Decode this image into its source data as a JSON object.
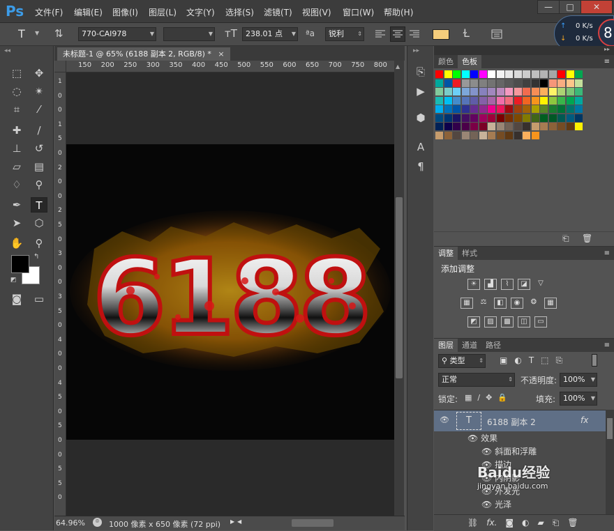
{
  "app": {
    "logo": "Ps"
  },
  "menus": [
    "文件(F)",
    "编辑(E)",
    "图像(I)",
    "图层(L)",
    "文字(Y)",
    "选择(S)",
    "滤镜(T)",
    "视图(V)",
    "窗口(W)",
    "帮助(H)"
  ],
  "window_buttons": {
    "minimize": "—",
    "maximize": "□",
    "close": "✕"
  },
  "network": {
    "up": "0 K/s",
    "down": "0 K/s",
    "badge": "8"
  },
  "options": {
    "tool_glyph": "T",
    "font_family": "770-CAI978",
    "font_style": "",
    "font_size": "238.01 点",
    "aa_label": "ªa",
    "antialias": "锐利",
    "text_color": "#f5cd7c"
  },
  "document": {
    "tab_title": "未标题-1 @ 65% (6188 副本 2, RGB/8) *",
    "close": "×",
    "artwork_text": "6188",
    "h_ruler": [
      "150",
      "200",
      "250",
      "300",
      "350",
      "400",
      "450",
      "500",
      "550",
      "600",
      "650",
      "700",
      "750",
      "800"
    ],
    "v_ruler": [
      "1",
      "0",
      "0",
      "1",
      "5",
      "0",
      "2",
      "0",
      "0",
      "2",
      "5",
      "0",
      "3",
      "0",
      "0",
      "3",
      "5",
      "0",
      "4",
      "0",
      "0",
      "4",
      "5",
      "0",
      "5",
      "0",
      "0",
      "5",
      "5",
      "0"
    ]
  },
  "status": {
    "zoom": "64.96%",
    "info": "1000 像素 x 650 像素 (72 ppi)"
  },
  "colors": {
    "foreground": "#000000",
    "background": "#ffffff"
  },
  "swatch_panel": {
    "tabs": [
      "颜色",
      "色板"
    ],
    "active": "色板",
    "rows": [
      [
        "#ff0000",
        "#ffff00",
        "#00ff00",
        "#00ffff",
        "#0000ff",
        "#ff00ff",
        "#ffffff",
        "#f2f2f2",
        "#e6e6e6",
        "#d9d9d9",
        "#cccccc",
        "#bfbfbf",
        "#b3b3b3",
        "#a6a6a6",
        "#ff0000",
        "#ffff00",
        "#00a650"
      ],
      [
        "#00a99d",
        "#0054a6",
        "#ed1c24",
        "#999999",
        "#8c8c8c",
        "#808080",
        "#737373",
        "#666666",
        "#595959",
        "#4d4d4d",
        "#404040",
        "#333333",
        "#000000",
        "#f69679",
        "#f9ad81",
        "#fdc68a",
        "#c4df9b"
      ],
      [
        "#82ca9c",
        "#7accc8",
        "#6dcff6",
        "#7da7d9",
        "#8393ca",
        "#8781bd",
        "#a187be",
        "#bd8cbf",
        "#f49ac1",
        "#f5989d",
        "#f26c4f",
        "#f68e56",
        "#fbaf5d",
        "#fff467",
        "#acd373",
        "#7cc576",
        "#3bb878"
      ],
      [
        "#1abbb4",
        "#00bff3",
        "#448ccb",
        "#5674b9",
        "#605ca8",
        "#8560a8",
        "#a864a8",
        "#f06eaa",
        "#f26d7d",
        "#ed1c24",
        "#f26522",
        "#f7941d",
        "#fff200",
        "#8dc63f",
        "#39b54a",
        "#00a651",
        "#00a99d"
      ],
      [
        "#00aeef",
        "#0072bc",
        "#0054a6",
        "#2e3192",
        "#662d91",
        "#92278f",
        "#ec008c",
        "#ed145b",
        "#9e0b0f",
        "#a0410d",
        "#a36209",
        "#aba000",
        "#598527",
        "#197b30",
        "#007236",
        "#00746b",
        "#0076a3"
      ],
      [
        "#004a80",
        "#003471",
        "#1b1464",
        "#440e62",
        "#630460",
        "#9e005d",
        "#9e0039",
        "#790000",
        "#7b2e00",
        "#7d4900",
        "#827b00",
        "#406618",
        "#005e20",
        "#005826",
        "#005952",
        "#005b7f",
        "#003663"
      ],
      [
        "#002157",
        "#0d004c",
        "#32004b",
        "#4b0049",
        "#7b0046",
        "#7a0026",
        "#c7b299",
        "#998675",
        "#736357",
        "#534741",
        "#37302d",
        "#c69c6d",
        "#a67c52",
        "#8c6239",
        "#754c24",
        "#603913",
        "#fff200"
      ],
      [
        "#c69c6d",
        "#8c6239",
        "#534741",
        "#998675",
        "#736357",
        "#c7b299",
        "#a67c52",
        "#754c24",
        "#603913",
        "#37302d",
        "#fbaf5d",
        "#f7941d"
      ]
    ]
  },
  "adjust_panel": {
    "tabs": [
      "调整",
      "样式"
    ],
    "title": "添加调整",
    "icons": [
      [
        "brightness-icon",
        "levels-icon",
        "curves-icon",
        "exposure-icon",
        "vibrance-icon"
      ],
      [
        "hue-icon",
        "colorbalance-icon",
        "bw-icon",
        "photofilter-icon",
        "channelmixer-icon",
        "colorlookup-icon"
      ],
      [
        "invert-icon",
        "posterize-icon",
        "threshold-icon",
        "selectivecolor-icon",
        "gradientmap-icon"
      ]
    ]
  },
  "layers_panel": {
    "tabs": [
      "图层",
      "通道",
      "路径"
    ],
    "filter_kind": "类型",
    "blend_mode": "正常",
    "opacity_label": "不透明度:",
    "opacity": "100%",
    "lock_label": "锁定:",
    "fill_label": "填充:",
    "fill": "100%",
    "layer_name": "6188 副本 2",
    "fx": "fx",
    "effects_label": "效果",
    "effects": [
      "斜面和浮雕",
      "描边",
      "内阴影",
      "外发光",
      "光泽"
    ]
  },
  "watermark": {
    "text": "Baidu经验",
    "sub": "jingyan.baidu.com"
  }
}
